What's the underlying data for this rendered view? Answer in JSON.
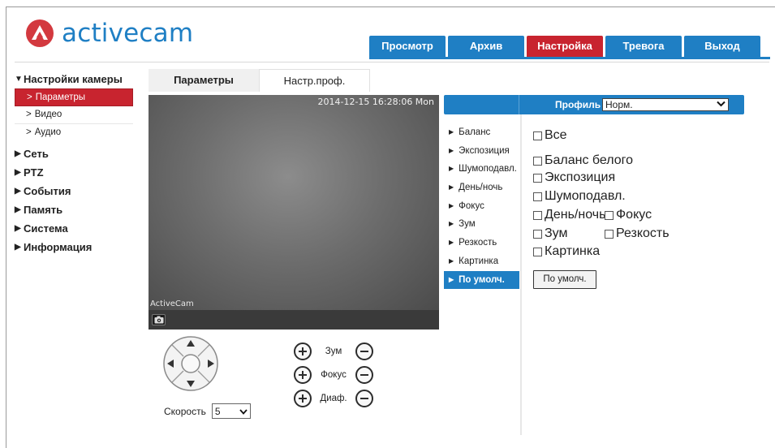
{
  "brand": {
    "name": "activecam",
    "logo_color": "#d3393f",
    "text_color": "#1f7fc4"
  },
  "topnav": {
    "tabs": [
      {
        "label": "Просмотр",
        "active": false
      },
      {
        "label": "Архив",
        "active": false
      },
      {
        "label": "Настройка",
        "active": true
      },
      {
        "label": "Тревога",
        "active": false
      },
      {
        "label": "Выход",
        "active": false
      }
    ]
  },
  "sidebar": {
    "camera_settings": "Настройки камеры",
    "sub_items": [
      "Параметры",
      "Видео",
      "Аудио"
    ],
    "groups": [
      "Сеть",
      "PTZ",
      "События",
      "Память",
      "Система",
      "Информация"
    ]
  },
  "subtabs": {
    "params": "Параметры",
    "profile_settings": "Настр.проф."
  },
  "video": {
    "timestamp": "2014-12-15 16:28:06 Mon",
    "watermark": "ActiveCam"
  },
  "ptz": {
    "speed_label": "Скорость",
    "speed_value": "5"
  },
  "lens": {
    "zoom": "Зум",
    "focus": "Фокус",
    "iris": "Диаф."
  },
  "image_panel": {
    "profile_label": "Профиль",
    "profile_value": "Норм.",
    "menu": [
      "Баланс",
      "Экспозиция",
      "Шумоподавл.",
      "День/ночь",
      "Фокус",
      "Зум",
      "Резкость",
      "Картинка",
      "По умолч."
    ],
    "active_menu": "По умолч.",
    "checkbox_all": "Все",
    "checkbox_wb": "Баланс белого",
    "checkbox_exposure": "Экспозиция",
    "checkbox_noise": "Шумоподавл.",
    "checkbox_daynight": "День/ночь",
    "checkbox_focus": "Фокус",
    "checkbox_zoom": "Зум",
    "checkbox_sharpness": "Резкость",
    "checkbox_picture": "Картинка",
    "default_button": "По умолч."
  },
  "colors": {
    "accent": "#1f7fc4",
    "active": "#c8242f"
  }
}
